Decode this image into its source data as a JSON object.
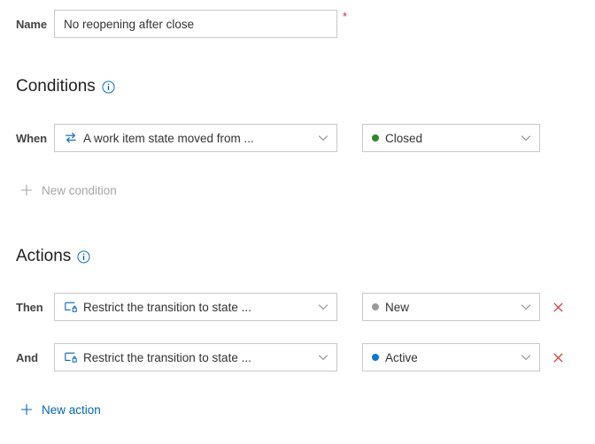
{
  "name_field": {
    "label": "Name",
    "value": "No reopening after close",
    "placeholder": "",
    "required_marker": "*"
  },
  "conditions": {
    "heading": "Conditions",
    "info_icon": "info-icon",
    "rows": [
      {
        "label": "When",
        "rule": {
          "icon": "transition-arrows-icon",
          "text": "A work item state moved from ..."
        },
        "value": {
          "text": "Closed",
          "dot_color": "#2a8a2a"
        }
      }
    ],
    "add_link": {
      "label": "New condition",
      "enabled": false
    }
  },
  "actions": {
    "heading": "Actions",
    "info_icon": "info-icon",
    "rows": [
      {
        "label": "Then",
        "rule": {
          "icon": "restrict-transition-icon",
          "text": "Restrict the transition to state ..."
        },
        "value": {
          "text": "New",
          "dot_color": "#999999"
        },
        "delete_icon": "close-icon"
      },
      {
        "label": "And",
        "rule": {
          "icon": "restrict-transition-icon",
          "text": "Restrict the transition to state ..."
        },
        "value": {
          "text": "Active",
          "dot_color": "#0078d4"
        },
        "delete_icon": "close-icon"
      }
    ],
    "add_link": {
      "label": "New action",
      "enabled": true
    }
  },
  "colors": {
    "accent": "#0067b8",
    "required": "#c4314b",
    "delete": "#d93025",
    "border": "#c8c8c8",
    "text": "#333333",
    "disabled_text": "#a6a6a6"
  }
}
